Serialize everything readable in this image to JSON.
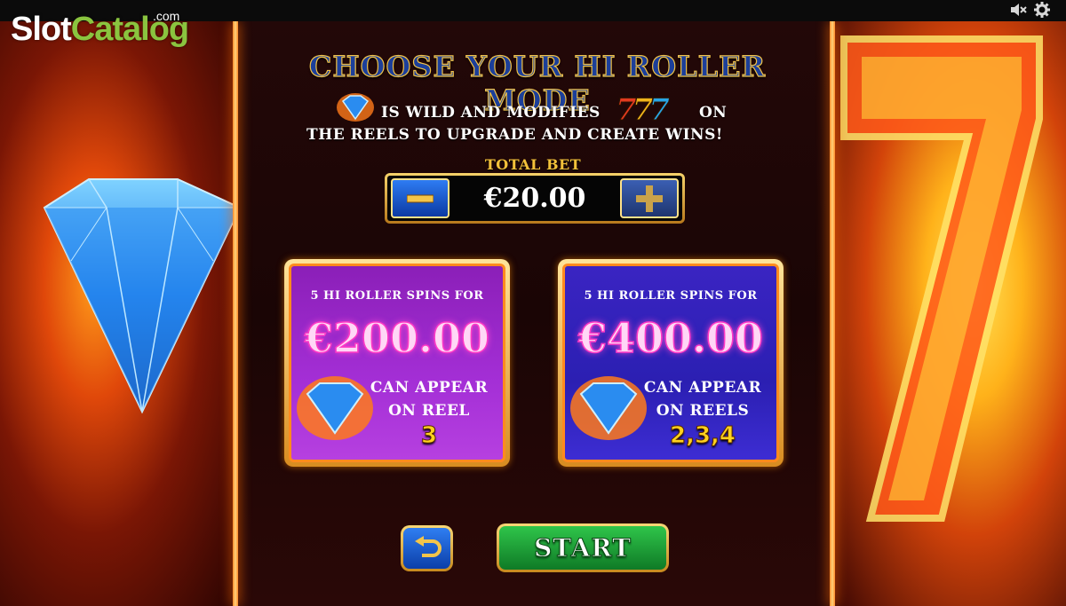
{
  "watermark": {
    "brand_part1": "Slot",
    "brand_part2": "Catalog",
    "suffix": ".com"
  },
  "top_controls": {
    "sound_icon": "speaker-muted-icon",
    "settings_icon": "gear-icon"
  },
  "title": "CHOOSE YOUR HI ROLLER MODE",
  "description": {
    "line1_part1": "IS WILD AND MODIFIES",
    "sevens": "777",
    "line1_part2": "ON",
    "line2": "THE REELS TO UPGRADE AND CREATE WINS!"
  },
  "bet": {
    "label": "TOTAL BET",
    "value": "€20.00",
    "minus_icon": "minus-icon",
    "plus_icon": "plus-icon"
  },
  "options": [
    {
      "head": "5 HI ROLLER SPINS FOR",
      "price": "€200.00",
      "appear": "CAN APPEAR ON REEL",
      "reels": "3",
      "color": "#a42fd6"
    },
    {
      "head": "5 HI ROLLER SPINS FOR",
      "price": "€400.00",
      "appear": "CAN APPEAR ON REELS",
      "reels": "2,3,4",
      "color": "#2b1fb2"
    }
  ],
  "buttons": {
    "back_icon": "return-arrow-icon",
    "start_label": "START"
  },
  "colors": {
    "title_fill": "#1c3f9a",
    "title_outline": "#f0c24a",
    "price_glow": "#ff39c6",
    "reel_numbers": "#ffd21e",
    "start_green": "#2fc54a"
  }
}
